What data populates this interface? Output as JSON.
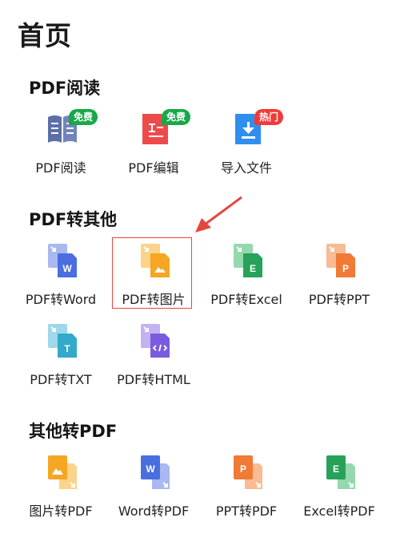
{
  "page": {
    "title": "首页"
  },
  "sections": [
    {
      "title": "PDF阅读",
      "items": [
        {
          "label": "PDF阅读",
          "icon": "book-icon",
          "badge": "免费",
          "badge_color": "#18a84a"
        },
        {
          "label": "PDF编辑",
          "icon": "edit-doc-icon",
          "badge": "免费",
          "badge_color": "#18a84a"
        },
        {
          "label": "导入文件",
          "icon": "import-file-icon",
          "badge": "热门",
          "badge_color": "#f13a3a"
        }
      ]
    },
    {
      "title": "PDF转其他",
      "items": [
        {
          "label": "PDF转Word",
          "icon": "pdf-to-word-icon"
        },
        {
          "label": "PDF转图片",
          "icon": "pdf-to-image-icon"
        },
        {
          "label": "PDF转Excel",
          "icon": "pdf-to-excel-icon"
        },
        {
          "label": "PDF转PPT",
          "icon": "pdf-to-ppt-icon"
        },
        {
          "label": "PDF转TXT",
          "icon": "pdf-to-txt-icon"
        },
        {
          "label": "PDF转HTML",
          "icon": "pdf-to-html-icon"
        }
      ]
    },
    {
      "title": "其他转PDF",
      "items": [
        {
          "label": "图片转PDF",
          "icon": "image-to-pdf-icon"
        },
        {
          "label": "Word转PDF",
          "icon": "word-to-pdf-icon"
        },
        {
          "label": "PPT转PDF",
          "icon": "ppt-to-pdf-icon"
        },
        {
          "label": "Excel转PDF",
          "icon": "excel-to-pdf-icon"
        }
      ]
    }
  ],
  "colors": {
    "pdf_blue": "#5b6fa8",
    "pdf_red": "#ef4a4a",
    "import_blue": "#2f8ff0",
    "word_blue": "#4a6ee0",
    "image_orange": "#f5a623",
    "excel_green": "#27a25a",
    "ppt_orange": "#f07a36",
    "txt_cyan": "#33aacc",
    "html_purple": "#7a5be0",
    "annotation_red": "#e3483f"
  }
}
